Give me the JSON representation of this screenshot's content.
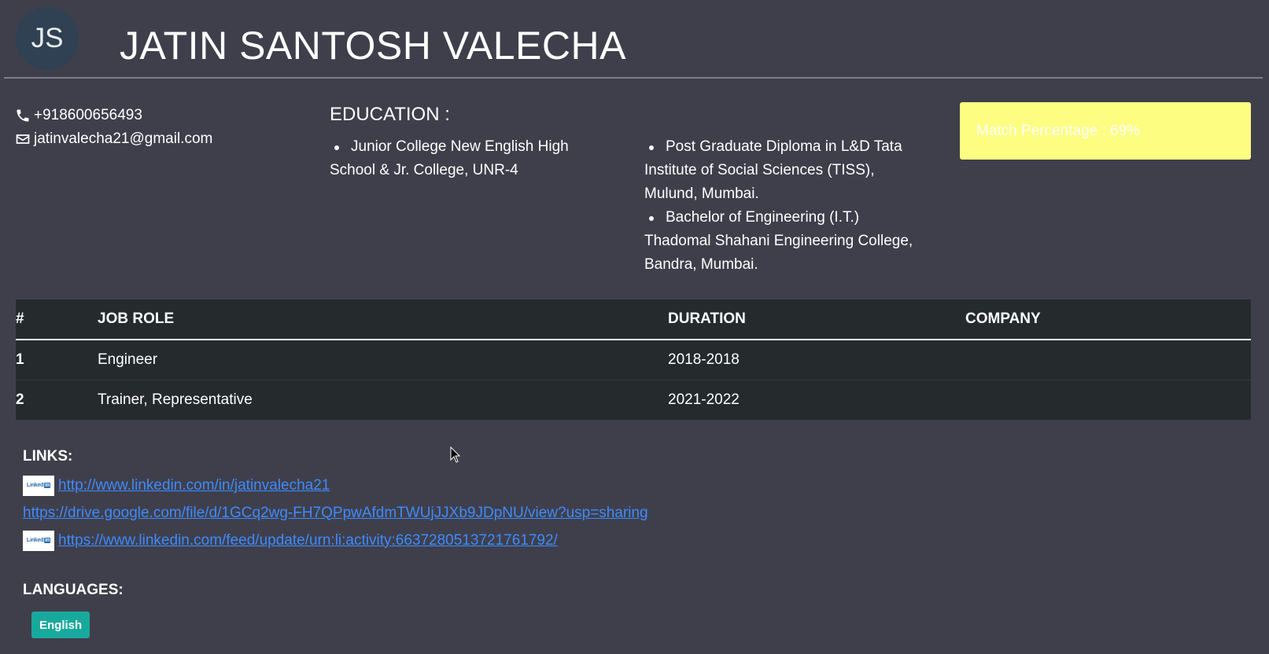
{
  "header": {
    "initials": "JS",
    "name": "JATIN SANTOSH VALECHA"
  },
  "contact": {
    "phone": "+918600656493",
    "email": "jatinvalecha21@gmail.com"
  },
  "education": {
    "title": "EDUCATION :",
    "column1": [
      "Junior College New English High School & Jr. College, UNR-4"
    ],
    "column2": [
      "Post Graduate Diploma in L&D Tata Institute of Social Sciences (TISS), Mulund, Mumbai.",
      "Bachelor of Engineering (I.T.) Thadomal Shahani Engineering College, Bandra, Mumbai."
    ]
  },
  "match": {
    "label": "Match Percentage : 69%",
    "color": "#fdfd82"
  },
  "jobs": {
    "headers": [
      "#",
      "JOB ROLE",
      "DURATION",
      "COMPANY"
    ],
    "rows": [
      {
        "num": "1",
        "role": "Engineer",
        "duration": "2018-2018",
        "company": ""
      },
      {
        "num": "2",
        "role": "Trainer, Representative",
        "duration": "2021-2022",
        "company": ""
      }
    ]
  },
  "links": {
    "title": "LINKS:",
    "items": [
      {
        "text": "http://www.linkedin.com/in/jatinvalecha21",
        "icon": "linkedin-icon"
      },
      {
        "text": "https://drive.google.com/file/d/1GCq2wg-FH7QPpwAfdmTWUjJJXb9JDpNU/view?usp=sharing",
        "icon": ""
      },
      {
        "text": "https://www.linkedin.com/feed/update/urn:li:activity:6637280513721761792/",
        "icon": "linkedin-icon"
      }
    ]
  },
  "languages": {
    "title": "LANGUAGES:",
    "items": [
      "English"
    ]
  },
  "colors": {
    "background": "#3f3f4c",
    "table": "#252b2d",
    "link": "#3d8bfd",
    "badge": "#18a99d"
  }
}
